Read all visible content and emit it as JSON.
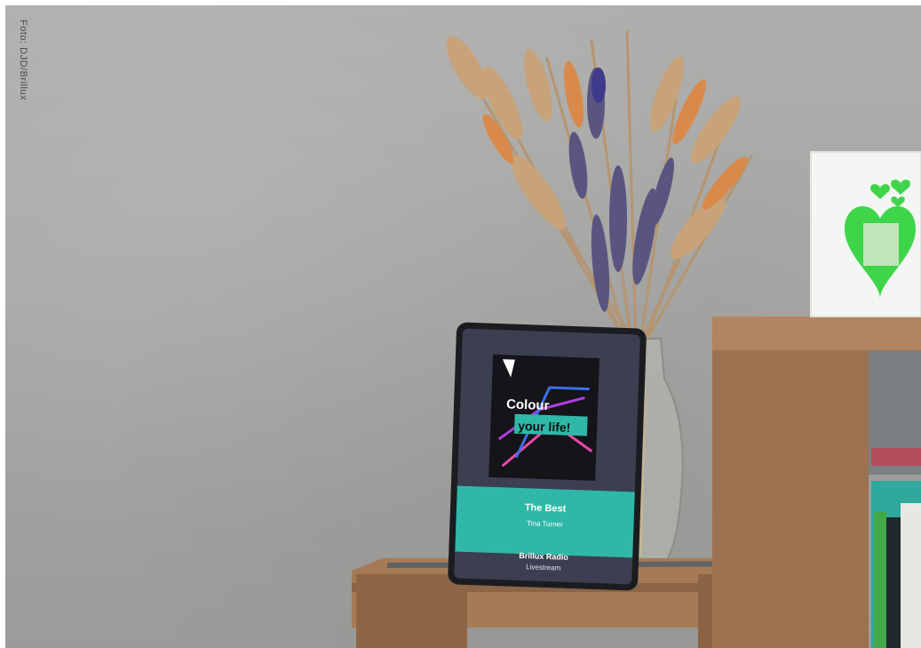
{
  "photo": {
    "credit": "Foto: DJD/Brillux"
  },
  "tablet": {
    "cover_text_line1": "Colour",
    "cover_text_line2": "your life!",
    "track_title": "The Best",
    "track_artist": "Tina Turner",
    "station_name": "Brillux Radio",
    "stream_label": "Livestream"
  },
  "colors": {
    "wall": "#a9a9a7",
    "wood": "#9a6f4c",
    "teal": "#2fb8a7",
    "screen_bg": "#3c3f52",
    "heart_green": "#3ed54a"
  }
}
